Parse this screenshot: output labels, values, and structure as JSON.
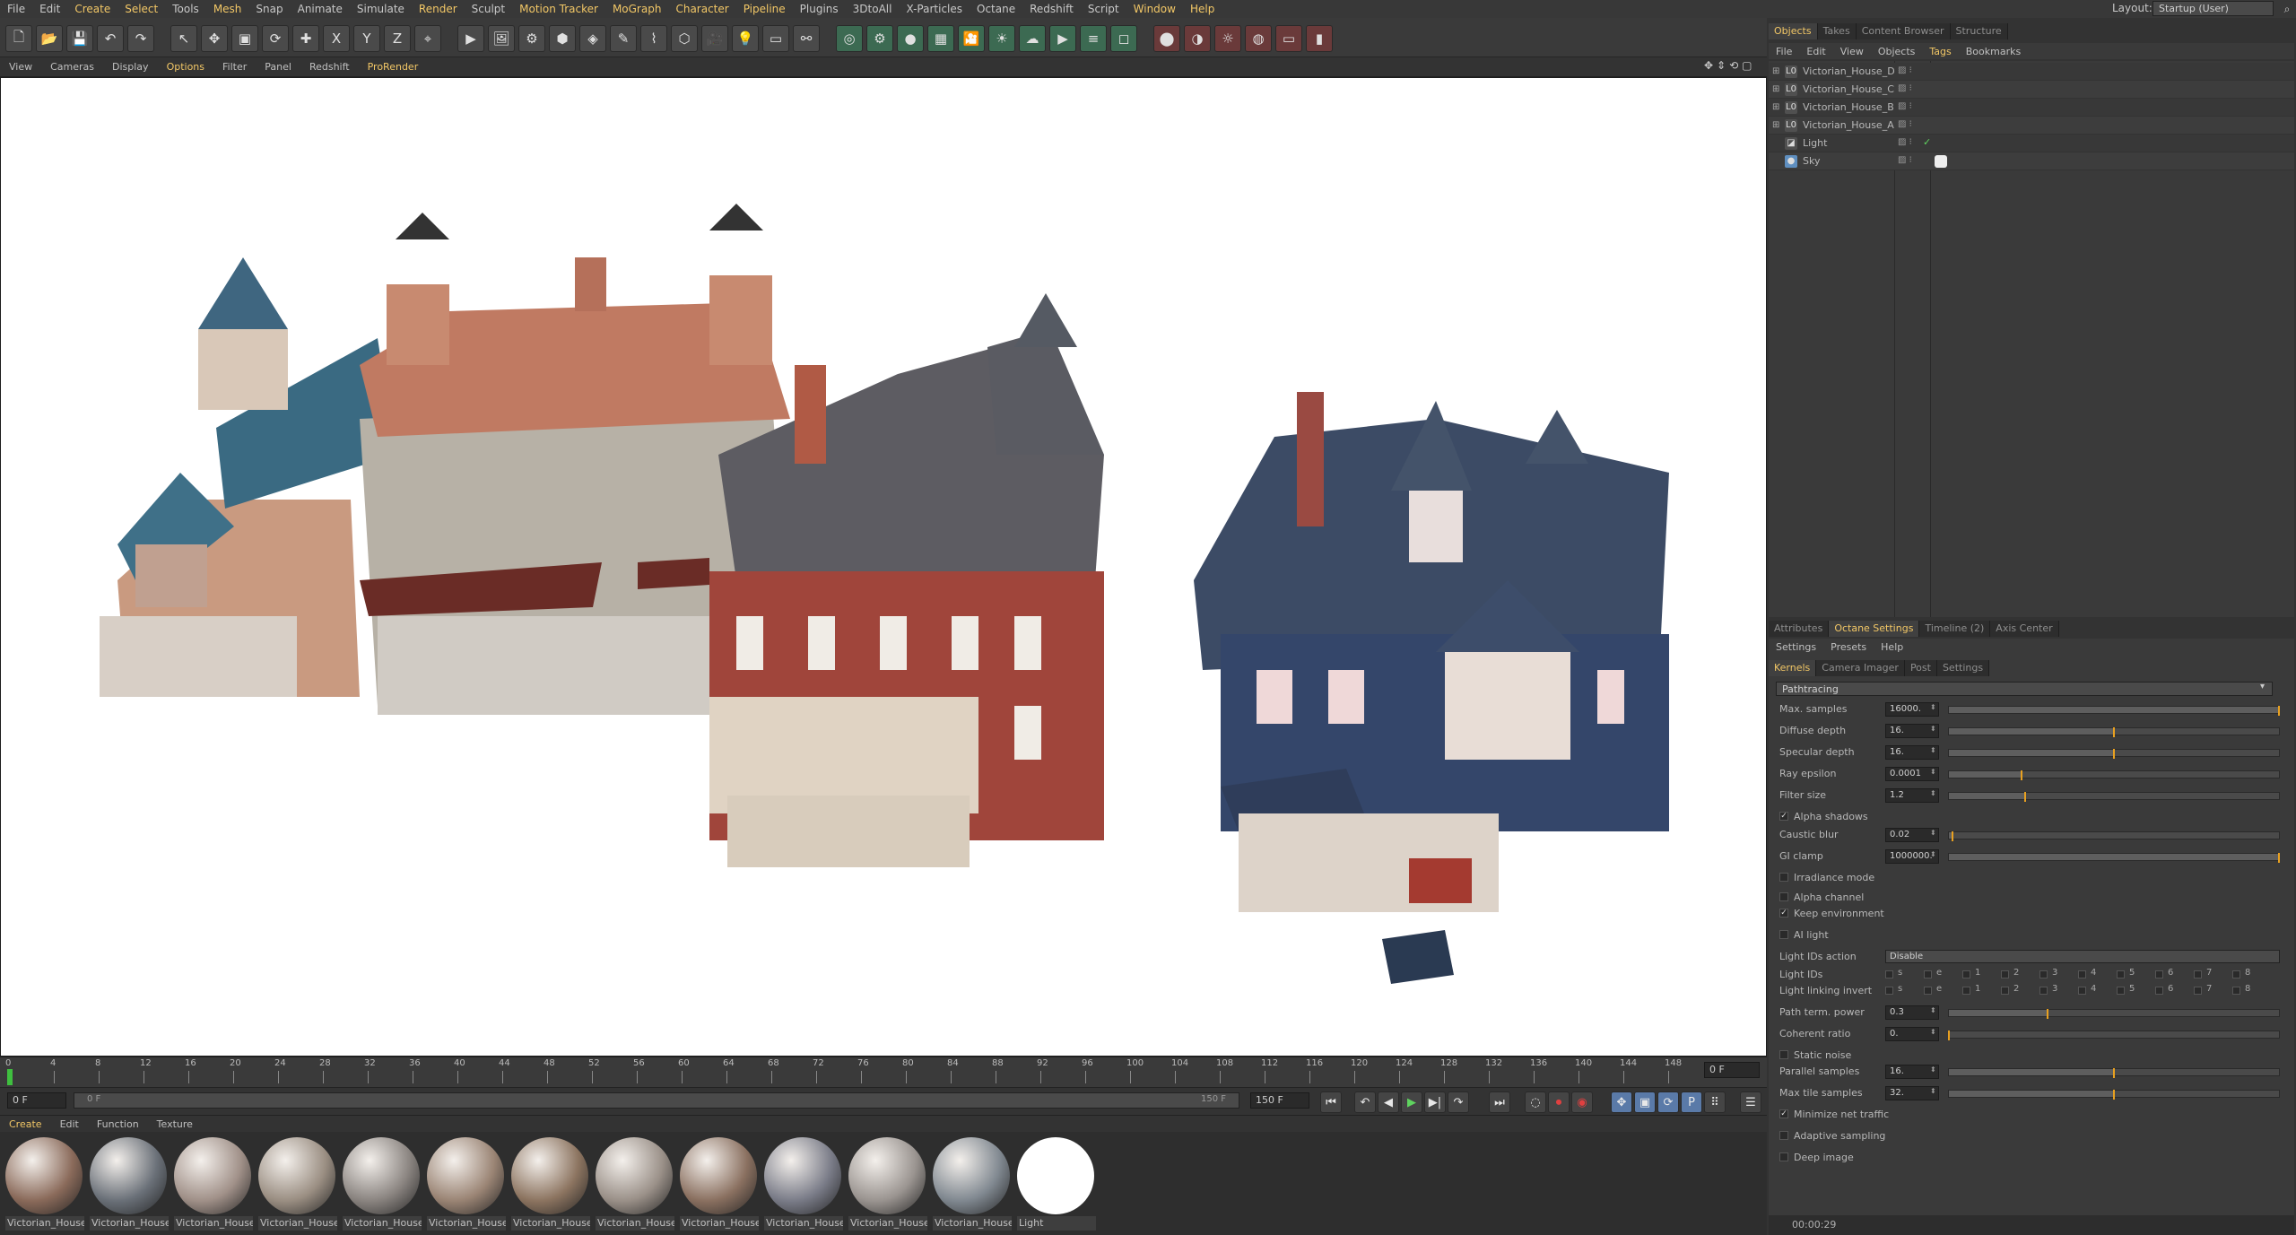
{
  "menubar": {
    "items": [
      {
        "label": "File"
      },
      {
        "label": "Edit"
      },
      {
        "label": "Create",
        "highlight": true
      },
      {
        "label": "Select",
        "highlight": true
      },
      {
        "label": "Tools"
      },
      {
        "label": "Mesh",
        "highlight": true
      },
      {
        "label": "Snap"
      },
      {
        "label": "Animate"
      },
      {
        "label": "Simulate"
      },
      {
        "label": "Render",
        "highlight": true
      },
      {
        "label": "Sculpt"
      },
      {
        "label": "Motion Tracker",
        "highlight": true
      },
      {
        "label": "MoGraph",
        "highlight": true
      },
      {
        "label": "Character",
        "highlight": true
      },
      {
        "label": "Pipeline",
        "highlight": true
      },
      {
        "label": "Plugins"
      },
      {
        "label": "3DtoAll"
      },
      {
        "label": "X-Particles"
      },
      {
        "label": "Octane"
      },
      {
        "label": "Redshift"
      },
      {
        "label": "Script"
      },
      {
        "label": "Window",
        "highlight": true
      },
      {
        "label": "Help",
        "highlight": true
      }
    ],
    "layout_label": "Layout:",
    "layout_value": "Startup (User)"
  },
  "toolbar": {
    "icons": [
      "new-file-icon",
      "open-icon",
      "save-icon",
      "undo-icon",
      "redo-icon",
      "live-select-icon",
      "move-icon",
      "scale-icon",
      "rotate-icon",
      "add-icon",
      "x-axis-icon",
      "y-axis-icon",
      "z-axis-icon",
      "coordinate-system-icon",
      "render-view-icon",
      "render-picture-viewer-icon",
      "render-settings-icon",
      "cube-icon",
      "sds-icon",
      "spline-pen-icon",
      "deformer-icon",
      "scene-icon",
      "camera-icon",
      "light-icon",
      "floor-icon",
      "ik-icon",
      "octane-live-viewer-icon",
      "octane-settings-icon",
      "octane-material-icon",
      "octane-texture-icon",
      "octane-camera-icon",
      "octane-light-icon",
      "octane-sky-icon",
      "octane-render-icon",
      "octane-layers-icon",
      "octane-object-icon",
      "redshift-render-icon",
      "redshift-ipr-icon",
      "redshift-light-icon",
      "redshift-dome-icon",
      "redshift-camera-icon",
      "redshift-tag-icon"
    ],
    "axis_x": "X",
    "axis_y": "Y",
    "axis_z": "Z"
  },
  "viewport_menu": {
    "items": [
      {
        "label": "View"
      },
      {
        "label": "Cameras"
      },
      {
        "label": "Display"
      },
      {
        "label": "Options",
        "highlight": true
      },
      {
        "label": "Filter"
      },
      {
        "label": "Panel"
      },
      {
        "label": "Redshift"
      },
      {
        "label": "ProRender",
        "highlight": true
      }
    ]
  },
  "timeline": {
    "ticks": [
      "0",
      "4",
      "8",
      "12",
      "16",
      "20",
      "24",
      "28",
      "32",
      "36",
      "40",
      "44",
      "48",
      "52",
      "56",
      "60",
      "64",
      "68",
      "72",
      "76",
      "80",
      "84",
      "88",
      "92",
      "96",
      "100",
      "104",
      "108",
      "112",
      "116",
      "120",
      "124",
      "128",
      "132",
      "136",
      "140",
      "144",
      "148"
    ],
    "current_frame_box": "0 F",
    "start_frame": "0 F",
    "range_start_label": "0 F",
    "range_end_label": "150 F",
    "end_frame": "150 F"
  },
  "material_menu": {
    "items": [
      {
        "label": "Create",
        "highlight": true
      },
      {
        "label": "Edit"
      },
      {
        "label": "Function"
      },
      {
        "label": "Texture"
      }
    ]
  },
  "materials": [
    {
      "label": "Victorian_House_",
      "color": "#8a6a5a"
    },
    {
      "label": "Victorian_House_",
      "color": "#6a7078"
    },
    {
      "label": "Victorian_House_",
      "color": "#a09088"
    },
    {
      "label": "Victorian_House_",
      "color": "#9a8e82"
    },
    {
      "label": "Victorian_House_",
      "color": "#8a8480"
    },
    {
      "label": "Victorian_House_",
      "color": "#9a8474"
    },
    {
      "label": "Victorian_House_",
      "color": "#8c7460"
    },
    {
      "label": "Victorian_House_",
      "color": "#9a9088"
    },
    {
      "label": "Victorian_House_",
      "color": "#8a7060"
    },
    {
      "label": "Victorian_House_",
      "color": "#7a7c88"
    },
    {
      "label": "Victorian_House_",
      "color": "#9a9490"
    },
    {
      "label": "Victorian_House_",
      "color": "#808890"
    },
    {
      "label": "Light",
      "color": "#ffffff"
    }
  ],
  "right_top_tabs": [
    {
      "label": "Objects",
      "active": true
    },
    {
      "label": "Takes"
    },
    {
      "label": "Content Browser"
    },
    {
      "label": "Structure"
    }
  ],
  "object_submenu": [
    {
      "label": "File"
    },
    {
      "label": "Edit"
    },
    {
      "label": "View"
    },
    {
      "label": "Objects"
    },
    {
      "label": "Tags",
      "highlight": true
    },
    {
      "label": "Bookmarks"
    }
  ],
  "objects": [
    {
      "name": "Victorian_House_D",
      "icon": "L0",
      "check": ""
    },
    {
      "name": "Victorian_House_C",
      "icon": "L0",
      "check": ""
    },
    {
      "name": "Victorian_House_B",
      "icon": "L0",
      "check": ""
    },
    {
      "name": "Victorian_House_A",
      "icon": "L0",
      "check": ""
    },
    {
      "name": "Light",
      "icon": "◪",
      "check": "✓"
    },
    {
      "name": "Sky",
      "icon": "●",
      "check": ""
    }
  ],
  "attr_tabs": [
    {
      "label": "Attributes"
    },
    {
      "label": "Octane Settings",
      "active": true
    },
    {
      "label": "Timeline (2)"
    },
    {
      "label": "Axis Center"
    }
  ],
  "settings_submenu": [
    {
      "label": "Settings"
    },
    {
      "label": "Presets"
    },
    {
      "label": "Help"
    }
  ],
  "kernel_tabs": [
    {
      "label": "Kernels",
      "active": true
    },
    {
      "label": "Camera Imager"
    },
    {
      "label": "Post"
    },
    {
      "label": "Settings"
    }
  ],
  "kernel_type": "Pathtracing",
  "params": [
    {
      "label": "Max. samples",
      "value": "16000.",
      "fill": 1.0
    },
    {
      "label": "Diffuse depth",
      "value": "16.",
      "fill": 0.5
    },
    {
      "label": "Specular depth",
      "value": "16.",
      "fill": 0.5
    },
    {
      "label": "Ray epsilon",
      "value": "0.0001",
      "fill": 0.22
    },
    {
      "label": "Filter size",
      "value": "1.2",
      "fill": 0.23
    }
  ],
  "alpha_shadows": "Alpha shadows",
  "params2": [
    {
      "label": "Caustic blur",
      "value": "0.02",
      "fill": 0.01
    },
    {
      "label": "GI clamp",
      "value": "1000000.",
      "fill": 1.0
    }
  ],
  "irradiance_mode": "Irradiance mode",
  "alpha_channel": "Alpha channel",
  "keep_environment": "Keep environment",
  "ai_light": "AI light",
  "light_ids_action": {
    "label": "Light IDs action",
    "value": "Disable"
  },
  "light_ids": {
    "label": "Light IDs",
    "items": [
      "s",
      "e",
      "1",
      "2",
      "3",
      "4",
      "5",
      "6",
      "7",
      "8"
    ]
  },
  "light_linking_invert": {
    "label": "Light linking invert",
    "items": [
      "s",
      "e",
      "1",
      "2",
      "3",
      "4",
      "5",
      "6",
      "7",
      "8"
    ]
  },
  "params3": [
    {
      "label": "Path term. power",
      "value": "0.3",
      "fill": 0.3
    },
    {
      "label": "Coherent ratio",
      "value": "0.",
      "fill": 0.0
    }
  ],
  "static_noise": "Static noise",
  "params4": [
    {
      "label": "Parallel samples",
      "value": "16.",
      "fill": 0.5
    },
    {
      "label": "Max tile samples",
      "value": "32.",
      "fill": 0.5
    }
  ],
  "minimize_net_traffic": "Minimize net traffic",
  "adaptive_sampling": "Adaptive sampling",
  "deep_image": "Deep image",
  "status_time": "00:00:29"
}
